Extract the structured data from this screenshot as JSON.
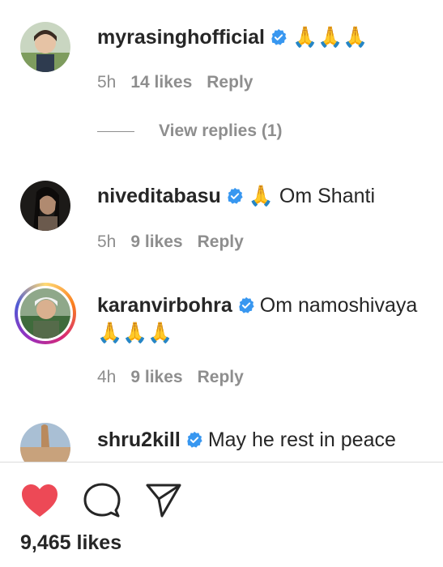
{
  "comments": [
    {
      "username": "myrasinghofficial",
      "text": "🙏🙏🙏",
      "time": "5h",
      "likes": "14 likes",
      "reply": "Reply",
      "view_replies": "View replies (1)"
    },
    {
      "username": "niveditabasu",
      "text": "🙏 Om Shanti",
      "time": "5h",
      "likes": "9 likes",
      "reply": "Reply"
    },
    {
      "username": "karanvirbohra",
      "text": "Om namoshivaya 🙏🙏🙏",
      "time": "4h",
      "likes": "9 likes",
      "reply": "Reply"
    },
    {
      "username": "shru2kill",
      "text": "May he rest in peace"
    }
  ],
  "footer": {
    "likes_count": "9,465 likes"
  },
  "colors": {
    "heart": "#ed4956",
    "verified": "#3897f0",
    "muted": "#8e8e8e",
    "text": "#262626"
  },
  "icons": {
    "like": "heart-icon",
    "comment": "comment-bubble-icon",
    "share": "paper-plane-icon"
  }
}
